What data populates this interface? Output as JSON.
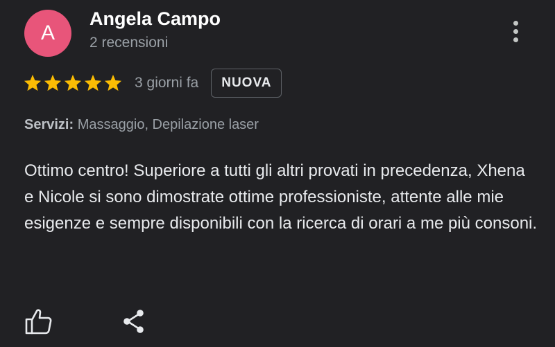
{
  "reviewer": {
    "avatar_letter": "A",
    "avatar_color": "#e8557a",
    "name": "Angela Campo",
    "review_count": "2 recensioni"
  },
  "menu": {
    "icon": "more-vertical-icon"
  },
  "rating": {
    "stars": 5,
    "max_stars": 5,
    "star_color": "#fbbc04",
    "date": "3 giorni fa",
    "badge": "NUOVA"
  },
  "services": {
    "label": "Servizi:",
    "value": "Massaggio, Depilazione laser"
  },
  "review_text": "Ottimo centro! Superiore a tutti gli altri provati in precedenza, Xhena e Nicole si sono dimostrate ottime professioniste, attente alle mie esigenze e sempre disponibili con la ricerca di orari a me più consoni.",
  "actions": {
    "like_icon": "thumbs-up-icon",
    "share_icon": "share-icon"
  },
  "colors": {
    "background": "#212124",
    "primary_text": "#e8eaed",
    "secondary_text": "#9aa0a6"
  }
}
